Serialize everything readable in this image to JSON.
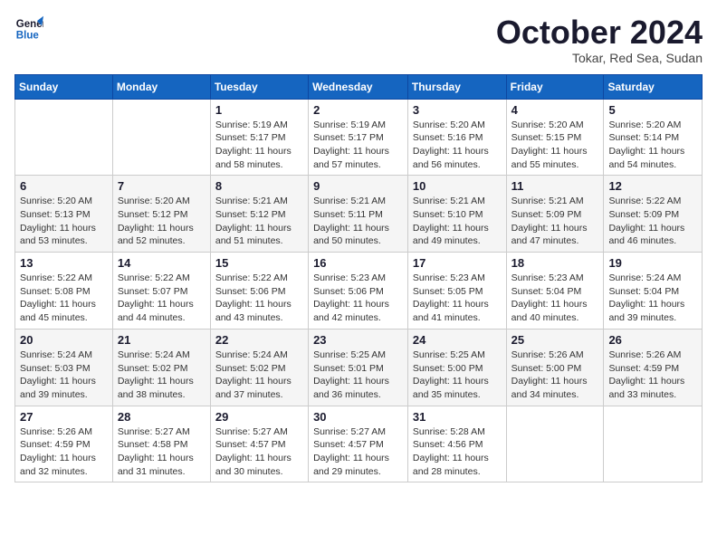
{
  "logo": {
    "line1": "General",
    "line2": "Blue"
  },
  "title": "October 2024",
  "subtitle": "Tokar, Red Sea, Sudan",
  "header_days": [
    "Sunday",
    "Monday",
    "Tuesday",
    "Wednesday",
    "Thursday",
    "Friday",
    "Saturday"
  ],
  "weeks": [
    [
      {
        "day": "",
        "sunrise": "",
        "sunset": "",
        "daylight": ""
      },
      {
        "day": "",
        "sunrise": "",
        "sunset": "",
        "daylight": ""
      },
      {
        "day": "1",
        "sunrise": "Sunrise: 5:19 AM",
        "sunset": "Sunset: 5:17 PM",
        "daylight": "Daylight: 11 hours and 58 minutes."
      },
      {
        "day": "2",
        "sunrise": "Sunrise: 5:19 AM",
        "sunset": "Sunset: 5:17 PM",
        "daylight": "Daylight: 11 hours and 57 minutes."
      },
      {
        "day": "3",
        "sunrise": "Sunrise: 5:20 AM",
        "sunset": "Sunset: 5:16 PM",
        "daylight": "Daylight: 11 hours and 56 minutes."
      },
      {
        "day": "4",
        "sunrise": "Sunrise: 5:20 AM",
        "sunset": "Sunset: 5:15 PM",
        "daylight": "Daylight: 11 hours and 55 minutes."
      },
      {
        "day": "5",
        "sunrise": "Sunrise: 5:20 AM",
        "sunset": "Sunset: 5:14 PM",
        "daylight": "Daylight: 11 hours and 54 minutes."
      }
    ],
    [
      {
        "day": "6",
        "sunrise": "Sunrise: 5:20 AM",
        "sunset": "Sunset: 5:13 PM",
        "daylight": "Daylight: 11 hours and 53 minutes."
      },
      {
        "day": "7",
        "sunrise": "Sunrise: 5:20 AM",
        "sunset": "Sunset: 5:12 PM",
        "daylight": "Daylight: 11 hours and 52 minutes."
      },
      {
        "day": "8",
        "sunrise": "Sunrise: 5:21 AM",
        "sunset": "Sunset: 5:12 PM",
        "daylight": "Daylight: 11 hours and 51 minutes."
      },
      {
        "day": "9",
        "sunrise": "Sunrise: 5:21 AM",
        "sunset": "Sunset: 5:11 PM",
        "daylight": "Daylight: 11 hours and 50 minutes."
      },
      {
        "day": "10",
        "sunrise": "Sunrise: 5:21 AM",
        "sunset": "Sunset: 5:10 PM",
        "daylight": "Daylight: 11 hours and 49 minutes."
      },
      {
        "day": "11",
        "sunrise": "Sunrise: 5:21 AM",
        "sunset": "Sunset: 5:09 PM",
        "daylight": "Daylight: 11 hours and 47 minutes."
      },
      {
        "day": "12",
        "sunrise": "Sunrise: 5:22 AM",
        "sunset": "Sunset: 5:09 PM",
        "daylight": "Daylight: 11 hours and 46 minutes."
      }
    ],
    [
      {
        "day": "13",
        "sunrise": "Sunrise: 5:22 AM",
        "sunset": "Sunset: 5:08 PM",
        "daylight": "Daylight: 11 hours and 45 minutes."
      },
      {
        "day": "14",
        "sunrise": "Sunrise: 5:22 AM",
        "sunset": "Sunset: 5:07 PM",
        "daylight": "Daylight: 11 hours and 44 minutes."
      },
      {
        "day": "15",
        "sunrise": "Sunrise: 5:22 AM",
        "sunset": "Sunset: 5:06 PM",
        "daylight": "Daylight: 11 hours and 43 minutes."
      },
      {
        "day": "16",
        "sunrise": "Sunrise: 5:23 AM",
        "sunset": "Sunset: 5:06 PM",
        "daylight": "Daylight: 11 hours and 42 minutes."
      },
      {
        "day": "17",
        "sunrise": "Sunrise: 5:23 AM",
        "sunset": "Sunset: 5:05 PM",
        "daylight": "Daylight: 11 hours and 41 minutes."
      },
      {
        "day": "18",
        "sunrise": "Sunrise: 5:23 AM",
        "sunset": "Sunset: 5:04 PM",
        "daylight": "Daylight: 11 hours and 40 minutes."
      },
      {
        "day": "19",
        "sunrise": "Sunrise: 5:24 AM",
        "sunset": "Sunset: 5:04 PM",
        "daylight": "Daylight: 11 hours and 39 minutes."
      }
    ],
    [
      {
        "day": "20",
        "sunrise": "Sunrise: 5:24 AM",
        "sunset": "Sunset: 5:03 PM",
        "daylight": "Daylight: 11 hours and 39 minutes."
      },
      {
        "day": "21",
        "sunrise": "Sunrise: 5:24 AM",
        "sunset": "Sunset: 5:02 PM",
        "daylight": "Daylight: 11 hours and 38 minutes."
      },
      {
        "day": "22",
        "sunrise": "Sunrise: 5:24 AM",
        "sunset": "Sunset: 5:02 PM",
        "daylight": "Daylight: 11 hours and 37 minutes."
      },
      {
        "day": "23",
        "sunrise": "Sunrise: 5:25 AM",
        "sunset": "Sunset: 5:01 PM",
        "daylight": "Daylight: 11 hours and 36 minutes."
      },
      {
        "day": "24",
        "sunrise": "Sunrise: 5:25 AM",
        "sunset": "Sunset: 5:00 PM",
        "daylight": "Daylight: 11 hours and 35 minutes."
      },
      {
        "day": "25",
        "sunrise": "Sunrise: 5:26 AM",
        "sunset": "Sunset: 5:00 PM",
        "daylight": "Daylight: 11 hours and 34 minutes."
      },
      {
        "day": "26",
        "sunrise": "Sunrise: 5:26 AM",
        "sunset": "Sunset: 4:59 PM",
        "daylight": "Daylight: 11 hours and 33 minutes."
      }
    ],
    [
      {
        "day": "27",
        "sunrise": "Sunrise: 5:26 AM",
        "sunset": "Sunset: 4:59 PM",
        "daylight": "Daylight: 11 hours and 32 minutes."
      },
      {
        "day": "28",
        "sunrise": "Sunrise: 5:27 AM",
        "sunset": "Sunset: 4:58 PM",
        "daylight": "Daylight: 11 hours and 31 minutes."
      },
      {
        "day": "29",
        "sunrise": "Sunrise: 5:27 AM",
        "sunset": "Sunset: 4:57 PM",
        "daylight": "Daylight: 11 hours and 30 minutes."
      },
      {
        "day": "30",
        "sunrise": "Sunrise: 5:27 AM",
        "sunset": "Sunset: 4:57 PM",
        "daylight": "Daylight: 11 hours and 29 minutes."
      },
      {
        "day": "31",
        "sunrise": "Sunrise: 5:28 AM",
        "sunset": "Sunset: 4:56 PM",
        "daylight": "Daylight: 11 hours and 28 minutes."
      },
      {
        "day": "",
        "sunrise": "",
        "sunset": "",
        "daylight": ""
      },
      {
        "day": "",
        "sunrise": "",
        "sunset": "",
        "daylight": ""
      }
    ]
  ]
}
